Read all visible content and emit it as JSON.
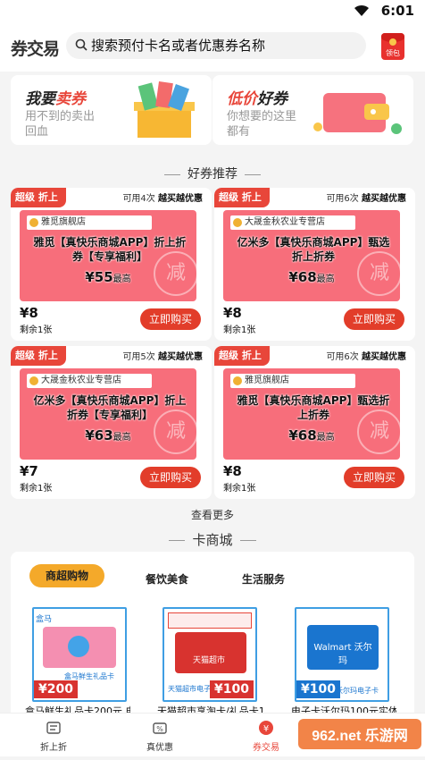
{
  "status": {
    "time": "6:01"
  },
  "header": {
    "logo": "券交易",
    "search_placeholder": "搜索预付卡名或者优惠券名称",
    "redpack_label": "领包"
  },
  "promos": [
    {
      "title_a": "我要",
      "title_b": "卖券",
      "sub": "用不到的卖出回血"
    },
    {
      "title_a": "低价",
      "title_b": "好券",
      "sub": "你想要的这里都有"
    }
  ],
  "section_deals": "好券推荐",
  "deals": [
    {
      "tag": "超级 折上折",
      "uses_a": "可用4次",
      "uses_b": "越买越优惠",
      "store": "雅觅旗舰店",
      "name": "雅觅【真快乐商城APP】折上折券【专享福利】",
      "amount": "¥55",
      "amount_suffix": "最高",
      "stamp": "减",
      "price": "¥8",
      "stock": "剩余1张",
      "buy": "立即购买"
    },
    {
      "tag": "超级 折上折",
      "uses_a": "可用6次",
      "uses_b": "越买越优惠",
      "store": "大晟金秋农业专营店",
      "name": "亿米多【真快乐商城APP】甄选折上折券",
      "amount": "¥68",
      "amount_suffix": "最高",
      "stamp": "减",
      "price": "¥8",
      "stock": "剩余1张",
      "buy": "立即购买"
    },
    {
      "tag": "超级 折上折",
      "uses_a": "可用5次",
      "uses_b": "越买越优惠",
      "store": "大晟金秋农业专营店",
      "name": "亿米多【真快乐商城APP】折上折券【专享福利】",
      "amount": "¥63",
      "amount_suffix": "最高",
      "stamp": "减",
      "price": "¥7",
      "stock": "剩余1张",
      "buy": "立即购买"
    },
    {
      "tag": "超级 折上折",
      "uses_a": "可用6次",
      "uses_b": "越买越优惠",
      "store": "雅觅旗舰店",
      "name": "雅觅【真快乐商城APP】甄选折上折券",
      "amount": "¥68",
      "amount_suffix": "最高",
      "stamp": "减",
      "price": "¥8",
      "stock": "剩余1张",
      "buy": "立即购买"
    }
  ],
  "more": "查看更多",
  "section_cards": "卡商城",
  "card_tabs": [
    "商超购物",
    "餐饮美食",
    "生活服务"
  ],
  "gift_cards": [
    {
      "price": "¥200",
      "brand": "盒马",
      "label": "盒马鲜生礼品卡",
      "name": "盒马鲜生礼品卡200元 电",
      "accent": "#e85d86"
    },
    {
      "price": "¥100",
      "brand": "天猫超市",
      "label": "天猫超市电子卡",
      "name": "天猫超市享淘卡/礼品卡100",
      "accent": "#d8332f"
    },
    {
      "price": "¥100",
      "brand": "Walmart 沃尔玛",
      "label": "沃尔玛电子卡",
      "name": "电子卡沃尔玛100元实体",
      "accent": "#1a75cf"
    }
  ],
  "nav": [
    {
      "label": "折上折",
      "active": false
    },
    {
      "label": "真优惠",
      "active": false
    },
    {
      "label": "券交易",
      "active": true
    }
  ],
  "watermark": "962.net 乐游网"
}
